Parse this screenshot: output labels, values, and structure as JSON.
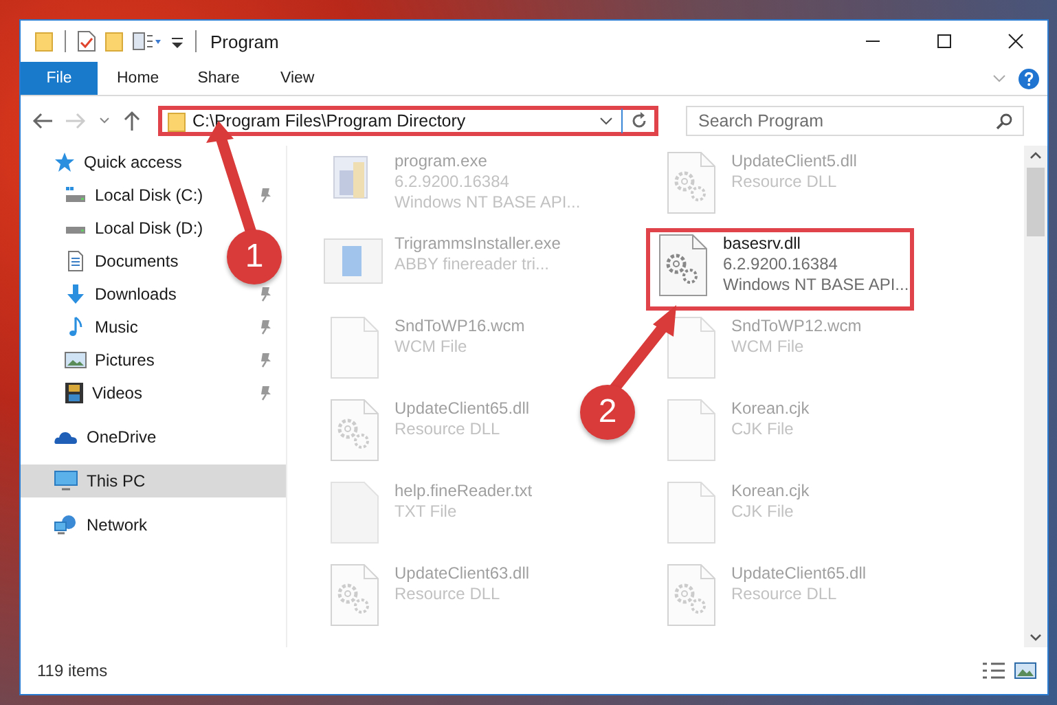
{
  "window": {
    "title": "Program"
  },
  "ribbon_tabs": [
    {
      "label": "File",
      "selected": true
    },
    {
      "label": "Home",
      "selected": false
    },
    {
      "label": "Share",
      "selected": false
    },
    {
      "label": "View",
      "selected": false
    }
  ],
  "address_bar": {
    "path": "C:\\Program Files\\Program Directory",
    "highlighted": true
  },
  "search": {
    "placeholder": "Search Program"
  },
  "sidebar": {
    "items": [
      {
        "label": "Quick access",
        "selected": false,
        "children": [
          {
            "label": "Local Disk (C:)",
            "pinned": true,
            "selected": false
          },
          {
            "label": "Local Disk (D:)",
            "pinned": false,
            "selected": false
          },
          {
            "label": "Documents",
            "pinned": false,
            "selected": false
          },
          {
            "label": "Downloads",
            "pinned": true,
            "selected": false
          },
          {
            "label": "Music",
            "pinned": true,
            "selected": false
          },
          {
            "label": "Pictures",
            "pinned": true,
            "selected": false
          },
          {
            "label": "Videos",
            "pinned": true,
            "selected": false
          }
        ]
      },
      {
        "label": "OneDrive",
        "selected": false
      },
      {
        "label": "This PC",
        "selected": true
      },
      {
        "label": "Network",
        "selected": false
      }
    ]
  },
  "files": [
    {
      "name": "program.exe",
      "details": [
        "6.2.9200.16384",
        "Windows NT BASE API..."
      ],
      "kind": "exe",
      "faded": true,
      "highlighted": false
    },
    {
      "name": "UpdateClient5.dll",
      "details": [
        "Resource DLL"
      ],
      "kind": "dll",
      "faded": true,
      "highlighted": false
    },
    {
      "name": "TrigrammsInstaller.exe",
      "details": [
        "ABBY finereader tri..."
      ],
      "kind": "app",
      "faded": true,
      "highlighted": false
    },
    {
      "name": "basesrv.dll",
      "details": [
        "6.2.9200.16384",
        "Windows NT BASE API..."
      ],
      "kind": "dll",
      "faded": false,
      "highlighted": true
    },
    {
      "name": "SndToWP16.wcm",
      "details": [
        "WCM File"
      ],
      "kind": "blank",
      "faded": true,
      "highlighted": false
    },
    {
      "name": "SndToWP12.wcm",
      "details": [
        "WCM File"
      ],
      "kind": "blank",
      "faded": true,
      "highlighted": false
    },
    {
      "name": "UpdateClient65.dll",
      "details": [
        "Resource DLL"
      ],
      "kind": "dll",
      "faded": true,
      "highlighted": false
    },
    {
      "name": "Korean.cjk",
      "details": [
        "CJK File"
      ],
      "kind": "blank",
      "faded": true,
      "highlighted": false
    },
    {
      "name": "help.fineReader.txt",
      "details": [
        "TXT File"
      ],
      "kind": "txt",
      "faded": true,
      "highlighted": false
    },
    {
      "name": "Korean.cjk",
      "details": [
        "CJK File"
      ],
      "kind": "blank",
      "faded": true,
      "highlighted": false
    },
    {
      "name": "UpdateClient63.dll",
      "details": [
        "Resource DLL"
      ],
      "kind": "dll",
      "faded": true,
      "highlighted": false
    },
    {
      "name": "UpdateClient65.dll",
      "details": [
        "Resource DLL"
      ],
      "kind": "dll",
      "faded": true,
      "highlighted": false
    }
  ],
  "status_bar": {
    "item_count": "119 items"
  },
  "callouts": [
    {
      "number": "1"
    },
    {
      "number": "2"
    }
  ]
}
